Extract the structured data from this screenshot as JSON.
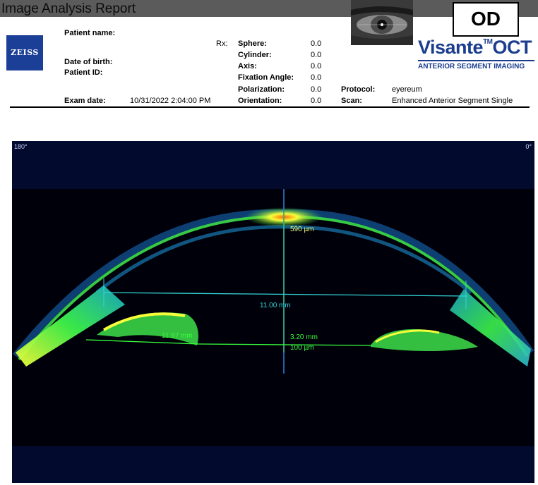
{
  "report": {
    "title": "Image Analysis Report",
    "od": "OD"
  },
  "brand": {
    "zeiss": "ZEISS",
    "product": "Visante",
    "tm": "TM",
    "product_suffix": "OCT",
    "subtitle": "ANTERIOR SEGMENT IMAGING",
    "color": "#1b3d8f"
  },
  "patient": {
    "name_label": "Patient name:",
    "dob_label": "Date of birth:",
    "id_label": "Patient ID:",
    "exam_date_label": "Exam date:",
    "exam_date": "10/31/2022 2:04:00 PM"
  },
  "rx": {
    "rx_label": "Rx:",
    "sphere_label": "Sphere:",
    "sphere": "0.0",
    "cylinder_label": "Cylinder:",
    "cylinder": "0.0",
    "axis_label": "Axis:",
    "axis": "0.0",
    "fixation_label": "Fixation Angle:",
    "fixation": "0.0",
    "polarization_label": "Polarization:",
    "polarization": "0.0",
    "orientation_label": "Orientation:",
    "orientation": "0.0"
  },
  "protocol": {
    "protocol_label": "Protocol:",
    "protocol": "eyereum",
    "scan_label": "Scan:",
    "scan": "Enhanced Anterior Segment Single"
  },
  "scan_image": {
    "left_angle": "180°",
    "right_angle": "0°",
    "measurements": {
      "central_thickness": "590 µm",
      "width": "11.00 mm",
      "iris_to_iris": "11.97 mm",
      "depth": "3.20 mm",
      "lens_offset": "100 µm"
    },
    "colors": {
      "tissue_green": "#39ff3c",
      "tissue_yellow": "#f6ff3a",
      "background": "#000010",
      "caliper": "#32d4d4"
    }
  }
}
